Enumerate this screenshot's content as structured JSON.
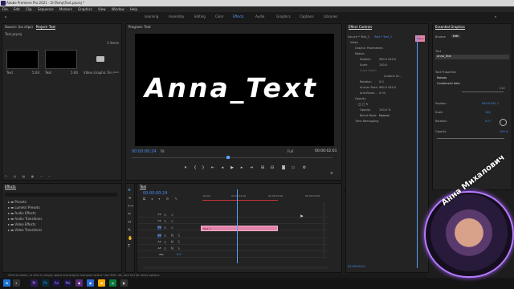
{
  "window": {
    "title": "Adobe Premiere Pro 2021 - D:\\Temp\\Text.prproj *"
  },
  "menu": [
    "File",
    "Edit",
    "Clip",
    "Sequence",
    "Markers",
    "Graphics",
    "View",
    "Window",
    "Help"
  ],
  "workspaces": [
    "Learning",
    "Assembly",
    "Editing",
    "Color",
    "Effects",
    "Audio",
    "Graphics",
    "Captions",
    "Libraries"
  ],
  "project": {
    "tabs": [
      "Source: (no clips)",
      "Project: Text"
    ],
    "file": "Text.prproj",
    "item_count": "3 items",
    "items": [
      {
        "name": "Text",
        "dur": "5:00"
      },
      {
        "name": "Text",
        "dur": "5:00"
      },
      {
        "name": "Video Graphic Te...",
        "dur": "1 item"
      }
    ]
  },
  "program": {
    "title": "Program: Text",
    "text": "Anna_Text",
    "timecode": "00:00:00:24",
    "fit": "Fit",
    "quality": "Full",
    "duration": "00:00:02:01"
  },
  "effect_controls": {
    "title": "Effect Controls",
    "source": "Source * Text_1",
    "seq": "Text * Text_1",
    "clip_label": "Text_1",
    "rows": [
      {
        "label": "Video",
        "value": ""
      },
      {
        "label": "Graphic Parameters",
        "value": ""
      },
      {
        "label": "Motion",
        "value": ""
      },
      {
        "label": "Position",
        "value": "960.0   540.0"
      },
      {
        "label": "Scale",
        "value": "100.0"
      },
      {
        "label": "Scale Width",
        "value": ""
      },
      {
        "label": "",
        "value": "Uniform Sc..."
      },
      {
        "label": "Rotation",
        "value": "0.0"
      },
      {
        "label": "Anchor Point",
        "value": "960.0   540.0"
      },
      {
        "label": "Anti-flicker...",
        "value": "0.00"
      },
      {
        "label": "Opacity",
        "value": ""
      },
      {
        "label": "Opacity",
        "value": "100.0 %"
      },
      {
        "label": "Blend Mode",
        "value": "Normal"
      },
      {
        "label": "Time Remapping",
        "value": ""
      }
    ],
    "footer_time": "00:00:00:24"
  },
  "essential_graphics": {
    "title": "Essential Graphics",
    "tabs": [
      "Browse",
      "Edit"
    ],
    "layer": "Text",
    "layer_value": "Anna_Text",
    "text_props": "Text Properties",
    "font": "Roboto",
    "style": "Condensed Italic",
    "size": "212",
    "position_label": "Position",
    "position": "959.5   591.1",
    "scale_label": "Scale",
    "scale": "100",
    "rotation_label": "Rotation",
    "rotation": "0.0 °",
    "opacity_label": "Opacity",
    "opacity": "100 %"
  },
  "effects": {
    "title": "Effects",
    "items": [
      "Presets",
      "Lumetri Presets",
      "Audio Effects",
      "Audio Transitions",
      "Video Effects",
      "Video Transitions"
    ]
  },
  "timeline": {
    "tab": "Text",
    "timecode": "00:00:00:24",
    "ruler": [
      ":00:00",
      "00:00:01:00",
      "00:00:02:00",
      "00:00:03:00"
    ],
    "tracks": [
      "V3",
      "V2",
      "V1",
      "A1",
      "A2",
      "A3",
      "Mix"
    ],
    "mix_value": "0.0",
    "clip": "Text_1"
  },
  "status": "Click to select, or click in empty space and drag to marquee select. Use Shift, Alt, and Ctrl for other options.",
  "webcam": {
    "name": "Анна Михалович"
  }
}
